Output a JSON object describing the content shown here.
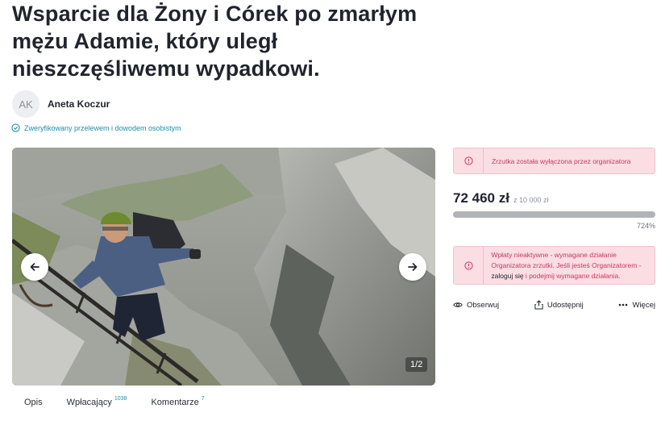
{
  "campaign": {
    "title": "Wsparcie dla Żony i Córek po zmarłym mężu Adamie, który uległ nieszczęśliwemu wypadkowi."
  },
  "author": {
    "initials": "AK",
    "name": "Aneta Koczur",
    "verified_text": "Zweryfikowany przelewem i dowodem osobistym"
  },
  "gallery": {
    "counter": "1/2"
  },
  "tabs": [
    {
      "label": "Opis",
      "count": ""
    },
    {
      "label": "Wpłacający",
      "count": "1038"
    },
    {
      "label": "Komentarze",
      "count": "7"
    }
  ],
  "status_alert": {
    "text": "Zrzutka została wyłączona przez organizatora"
  },
  "funding": {
    "raised": "72 460 zł",
    "goal_text": "z 10 000 zł",
    "percent_text": "724%",
    "progress_fraction": 1.0
  },
  "payments_alert": {
    "text_before": "Wpłaty nieaktywne - wymagane działanie Organizatora zrzutki. Jeśli jesteś Organizatorem - ",
    "login_link": "zaloguj się",
    "text_middle": " i ",
    "action_link": "podejmij wymagane działania",
    "text_after": "."
  },
  "actions": {
    "watch": "Obserwuj",
    "share": "Udostępnij",
    "more": "Więcej"
  },
  "colors": {
    "accent": "#1c8fa8",
    "alert_bg": "#fbdde4",
    "alert_text": "#c53a60",
    "progress": "#b0b3b8"
  }
}
